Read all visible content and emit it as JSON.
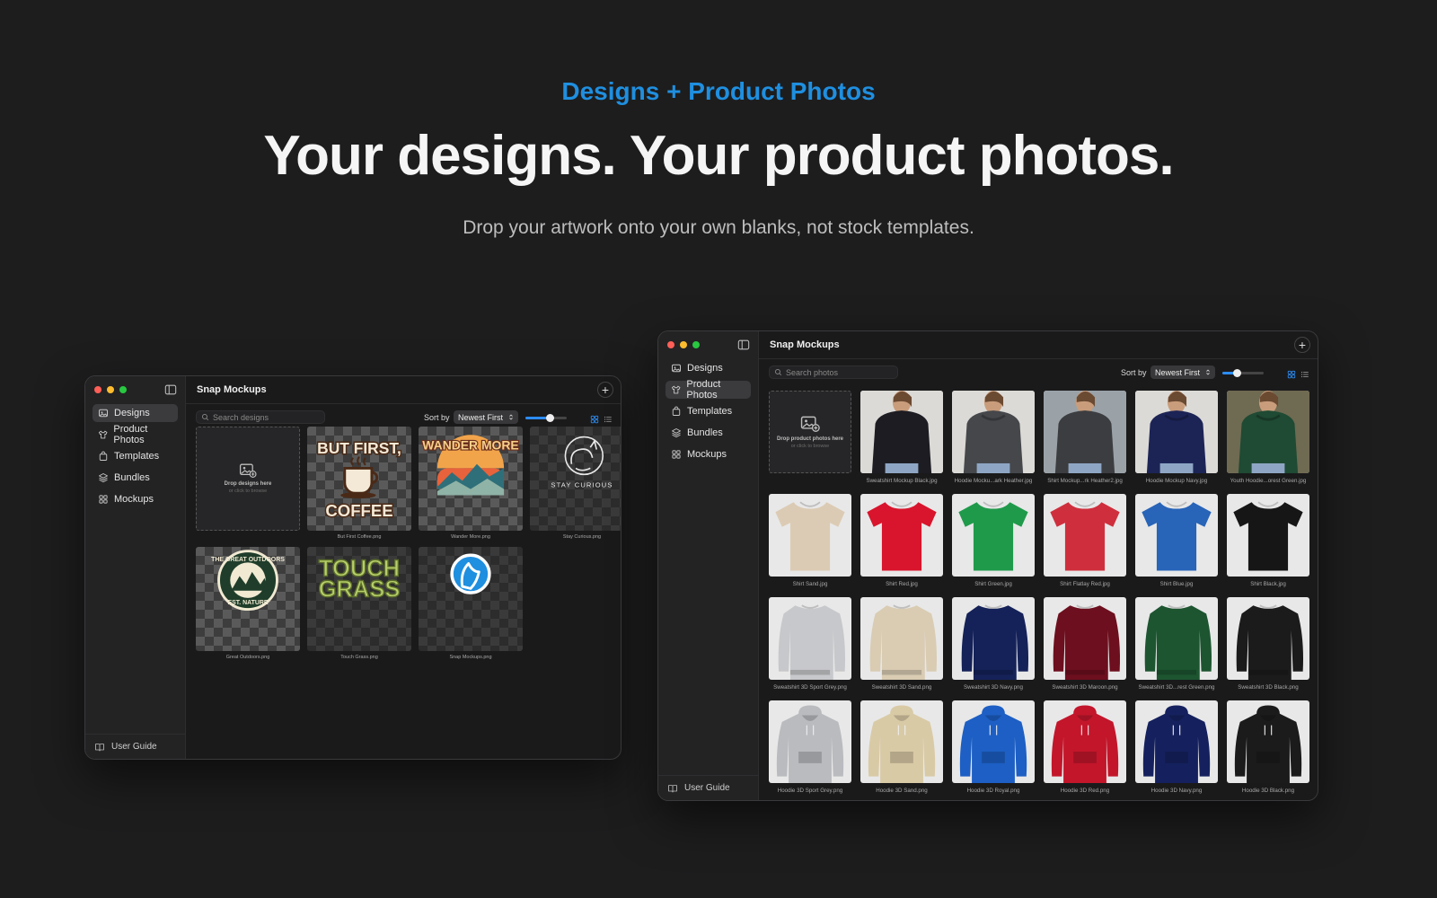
{
  "hero": {
    "eyebrow": "Designs + Product Photos",
    "headline": "Your designs. Your product photos.",
    "subline": "Drop your artwork onto your own blanks, not stock templates."
  },
  "nav_items": [
    {
      "label": "Designs",
      "icon": "image-stack-icon"
    },
    {
      "label": "Product Photos",
      "icon": "shirt-icon"
    },
    {
      "label": "Templates",
      "icon": "bag-icon"
    },
    {
      "label": "Bundles",
      "icon": "layers-icon"
    },
    {
      "label": "Mockups",
      "icon": "grid-icon"
    }
  ],
  "window_left": {
    "app_title": "Snap Mockups",
    "active_nav": "Designs",
    "search_placeholder": "Search designs",
    "sort_label": "Sort by",
    "sort_value": "Newest First",
    "thumb_size_level": 0.6,
    "dropzone": {
      "title": "Drop designs here",
      "hint": "or click to browse"
    },
    "designs": [
      {
        "caption": "But First Coffee.png",
        "art_lines": [
          "BUT FIRST,",
          "COFFEE"
        ]
      },
      {
        "caption": "Wander More.png",
        "art_lines": [
          "WANDER MORE"
        ]
      },
      {
        "caption": "Stay Curious.png",
        "art_lines": [
          "STAY CURIOUS"
        ]
      },
      {
        "caption": "Great Outdoors.png",
        "art_lines": [
          "THE GREAT OUTDOORS",
          "EST. NATURE"
        ]
      },
      {
        "caption": "Touch Grass.png",
        "art_lines": [
          "TOUCH",
          "GRASS"
        ]
      },
      {
        "caption": "Snap Mockups.png",
        "art_lines": []
      }
    ],
    "user_guide": "User Guide"
  },
  "window_right": {
    "app_title": "Snap Mockups",
    "active_nav": "Product Photos",
    "search_placeholder": "Search photos",
    "sort_label": "Sort by",
    "sort_value": "Newest First",
    "thumb_size_level": 0.35,
    "dropzone": {
      "title": "Drop product photos here",
      "hint": "or click to browse"
    },
    "photos": [
      {
        "caption": "Sweatshirt Mockup Black.jpg",
        "kind": "model-sweat",
        "color": "#1c1c22"
      },
      {
        "caption": "Hoodie Mocku...ark Heather.jpg",
        "kind": "model-hoodie",
        "color": "#45474b"
      },
      {
        "caption": "Shirt Mockup...rk Heather2.jpg",
        "kind": "model-tee",
        "color": "#3c3d40"
      },
      {
        "caption": "Hoodie Mockup Navy.jpg",
        "kind": "model-hoodie",
        "color": "#1c2456"
      },
      {
        "caption": "Youth Hoodie...orest Green.jpg",
        "kind": "model-hoodie",
        "color": "#1f4a33"
      },
      {
        "caption": "Shirt Sand.jpg",
        "kind": "tee",
        "color": "#dccbb4"
      },
      {
        "caption": "Shirt Red.jpg",
        "kind": "tee",
        "color": "#d8152c"
      },
      {
        "caption": "Shirt Green.jpg",
        "kind": "tee",
        "color": "#1f9a4b"
      },
      {
        "caption": "Shirt Flatlay Red.jpg",
        "kind": "tee",
        "color": "#cf2f3d"
      },
      {
        "caption": "Shirt Blue.jpg",
        "kind": "tee",
        "color": "#2864b8"
      },
      {
        "caption": "Shirt Black.jpg",
        "kind": "tee",
        "color": "#161616"
      },
      {
        "caption": "Sweatshirt 3D Sport Grey.png",
        "kind": "sweat",
        "color": "#c7c8cb"
      },
      {
        "caption": "Sweatshirt 3D Sand.png",
        "kind": "sweat",
        "color": "#d9ccb3"
      },
      {
        "caption": "Sweatshirt 3D Navy.png",
        "kind": "sweat",
        "color": "#152259"
      },
      {
        "caption": "Sweatshirt 3D Maroon.png",
        "kind": "sweat",
        "color": "#6d0f1e"
      },
      {
        "caption": "Sweatshirt 3D...rest Green.png",
        "kind": "sweat",
        "color": "#1d5530"
      },
      {
        "caption": "Sweatshirt 3D Black.png",
        "kind": "sweat",
        "color": "#1b1b1b"
      },
      {
        "caption": "Hoodie 3D Sport Grey.png",
        "kind": "hoodie",
        "color": "#b9bbbf"
      },
      {
        "caption": "Hoodie 3D Sand.png",
        "kind": "hoodie",
        "color": "#d9caa6"
      },
      {
        "caption": "Hoodie 3D Royal.png",
        "kind": "hoodie",
        "color": "#1d5fc4"
      },
      {
        "caption": "Hoodie 3D Red.png",
        "kind": "hoodie",
        "color": "#c3162b"
      },
      {
        "caption": "Hoodie 3D Navy.png",
        "kind": "hoodie",
        "color": "#15215e"
      },
      {
        "caption": "Hoodie 3D Black.png",
        "kind": "hoodie",
        "color": "#1b1b1b"
      }
    ],
    "user_guide": "User Guide"
  },
  "colors": {
    "accent": "#1f8fe0",
    "background": "#1d1d1e",
    "traffic_red": "#ff5f57",
    "traffic_yellow": "#febc2e",
    "traffic_green": "#28c840"
  }
}
